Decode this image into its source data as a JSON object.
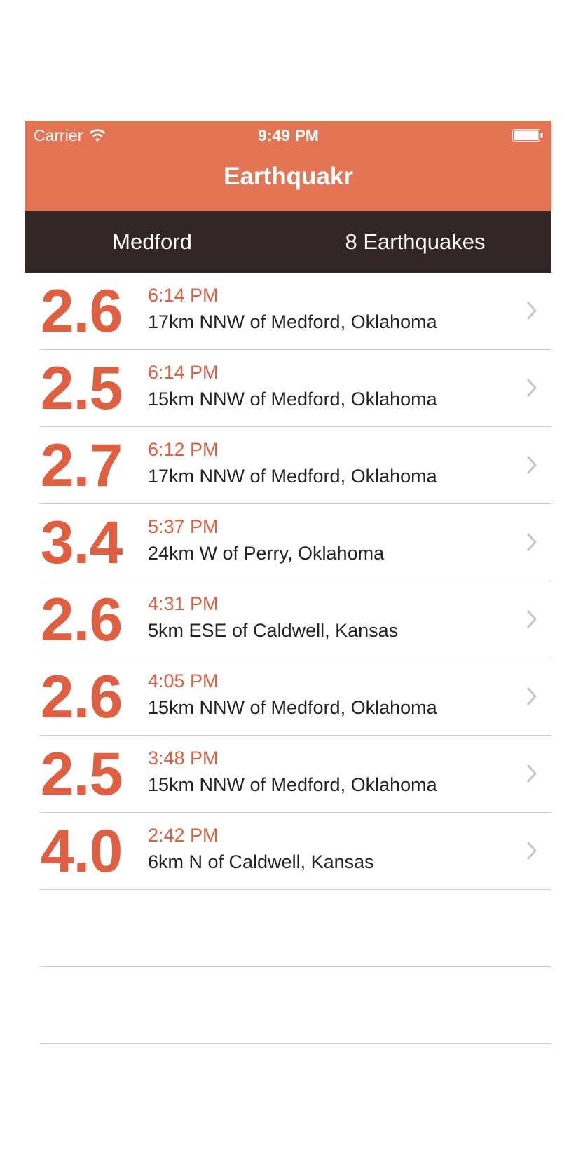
{
  "status_bar": {
    "carrier": "Carrier",
    "time": "9:49 PM",
    "icons": [
      "wifi-icon",
      "battery-icon"
    ]
  },
  "nav": {
    "title": "Earthquakr"
  },
  "subbar": {
    "location": "Medford",
    "count": "8 Earthquakes"
  },
  "colors": {
    "nav_bg": "#e37555",
    "subbar_bg": "#322626",
    "accent": "#df5f40"
  },
  "quakes": [
    {
      "magnitude": "2.6",
      "time": "6:14 PM",
      "place": "17km NNW of Medford, Oklahoma"
    },
    {
      "magnitude": "2.5",
      "time": "6:14 PM",
      "place": "15km NNW of Medford, Oklahoma"
    },
    {
      "magnitude": "2.7",
      "time": "6:12 PM",
      "place": "17km NNW of Medford, Oklahoma"
    },
    {
      "magnitude": "3.4",
      "time": "5:37 PM",
      "place": "24km W of Perry, Oklahoma"
    },
    {
      "magnitude": "2.6",
      "time": "4:31 PM",
      "place": "5km ESE of Caldwell, Kansas"
    },
    {
      "magnitude": "2.6",
      "time": "4:05 PM",
      "place": "15km NNW of Medford, Oklahoma"
    },
    {
      "magnitude": "2.5",
      "time": "3:48 PM",
      "place": "15km NNW of Medford, Oklahoma"
    },
    {
      "magnitude": "4.0",
      "time": "2:42 PM",
      "place": "6km N of Caldwell, Kansas"
    }
  ]
}
